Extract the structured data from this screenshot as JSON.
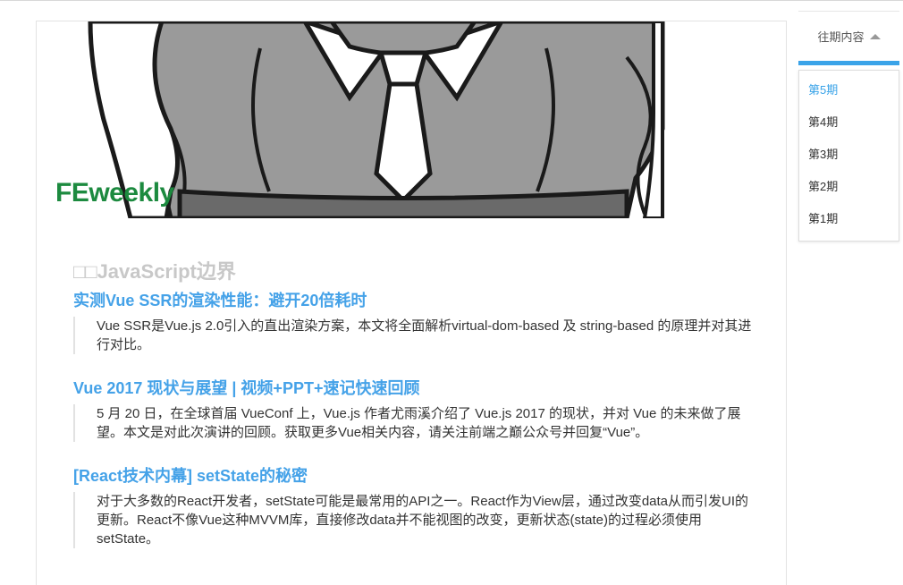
{
  "site": {
    "title": "FEweekly"
  },
  "section": {
    "heading": "□□JavaScript边界"
  },
  "articles": [
    {
      "title": "实测Vue SSR的渲染性能：避开20倍耗时",
      "desc": "Vue SSR是Vue.js 2.0引入的直出渲染方案，本文将全面解析virtual-dom-based 及 string-based 的原理并对其进行对比。"
    },
    {
      "title": "Vue 2017 现状与展望 | 视频+PPT+速记快速回顾",
      "desc": "5 月 20 日，在全球首届 VueConf 上，Vue.js 作者尤雨溪介绍了 Vue.js 2017 的现状，并对 Vue 的未来做了展望。本文是对此次演讲的回顾。获取更多Vue相关内容，请关注前端之巅公众号并回复“Vue”。"
    },
    {
      "title": "[React技术内幕] setState的秘密",
      "desc": "对于大多数的React开发者，setState可能是最常用的API之一。React作为View层，通过改变data从而引发UI的更新。React不像Vue这种MVVM库，直接修改data并不能视图的改变，更新状态(state)的过程必须使用setState。"
    }
  ],
  "sidebar": {
    "header": "往期内容",
    "toggle_icon": "caret-up-icon",
    "accent_color": "#3aa3e8",
    "issues": [
      {
        "label": "第5期",
        "active": true
      },
      {
        "label": "第4期",
        "active": false
      },
      {
        "label": "第3期",
        "active": false
      },
      {
        "label": "第2期",
        "active": false
      },
      {
        "label": "第1期",
        "active": false
      }
    ]
  },
  "colors": {
    "site_title": "#1c8a3f",
    "article_link": "#45a2e8",
    "section_heading": "#c8c8c8"
  }
}
